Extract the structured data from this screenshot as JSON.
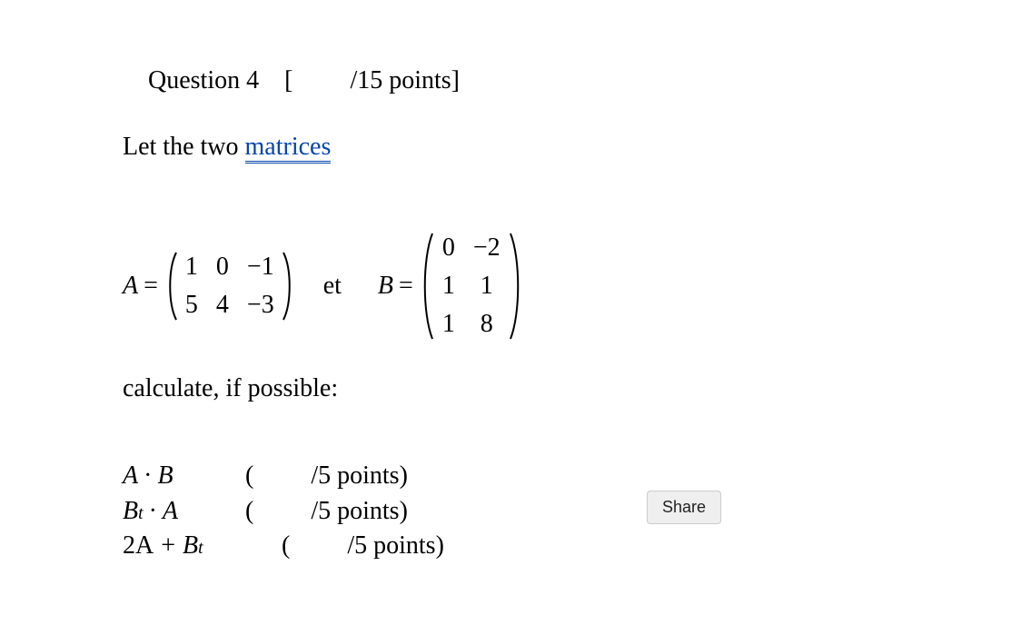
{
  "heading": {
    "label": "Question 4",
    "bracket_open": "[",
    "points": "/15 points]"
  },
  "intro": {
    "prefix": "Let the two ",
    "link_text": "matrices"
  },
  "matrixA": {
    "var": "A",
    "rows": [
      [
        "1",
        "0",
        "−1"
      ],
      [
        "5",
        "4",
        "−3"
      ]
    ]
  },
  "connector": "et",
  "matrixB": {
    "var": "B",
    "rows": [
      [
        "0",
        "−2"
      ],
      [
        "1",
        "1"
      ],
      [
        "1",
        "8"
      ]
    ]
  },
  "calculate_label": "calculate, if possible:",
  "tasks": {
    "t1": {
      "expr_parts": {
        "a": "A",
        "dot": "·",
        "b": "B"
      },
      "points_open": "(",
      "points": "/5 points)"
    },
    "t2": {
      "expr_parts": {
        "a": "B",
        "sup": "t",
        "dot": "·",
        "b": "A"
      },
      "points_open": "(",
      "points": "/5 points)"
    },
    "t3": {
      "expr_parts": {
        "a": "2A",
        "plus": "+",
        "b": "B",
        "sup": "t"
      },
      "points_open": "(",
      "points": "/5 points)"
    }
  },
  "share_button": "Share"
}
